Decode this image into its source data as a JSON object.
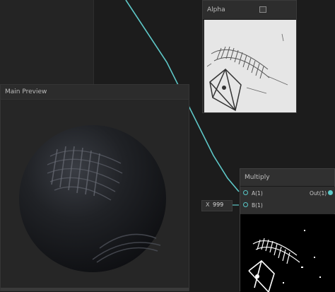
{
  "alpha_node": {
    "title": "Alpha"
  },
  "main_preview": {
    "title": "Main Preview"
  },
  "multiply_node": {
    "title": "Multiply",
    "inputs": [
      "A(1)",
      "B(1)"
    ],
    "output": "Out(1)"
  },
  "x_input": {
    "label": "X",
    "value": "999"
  },
  "colors": {
    "wire": "#5ec8c8",
    "background": "#1c1c1c",
    "panel": "#2a2a2a"
  }
}
